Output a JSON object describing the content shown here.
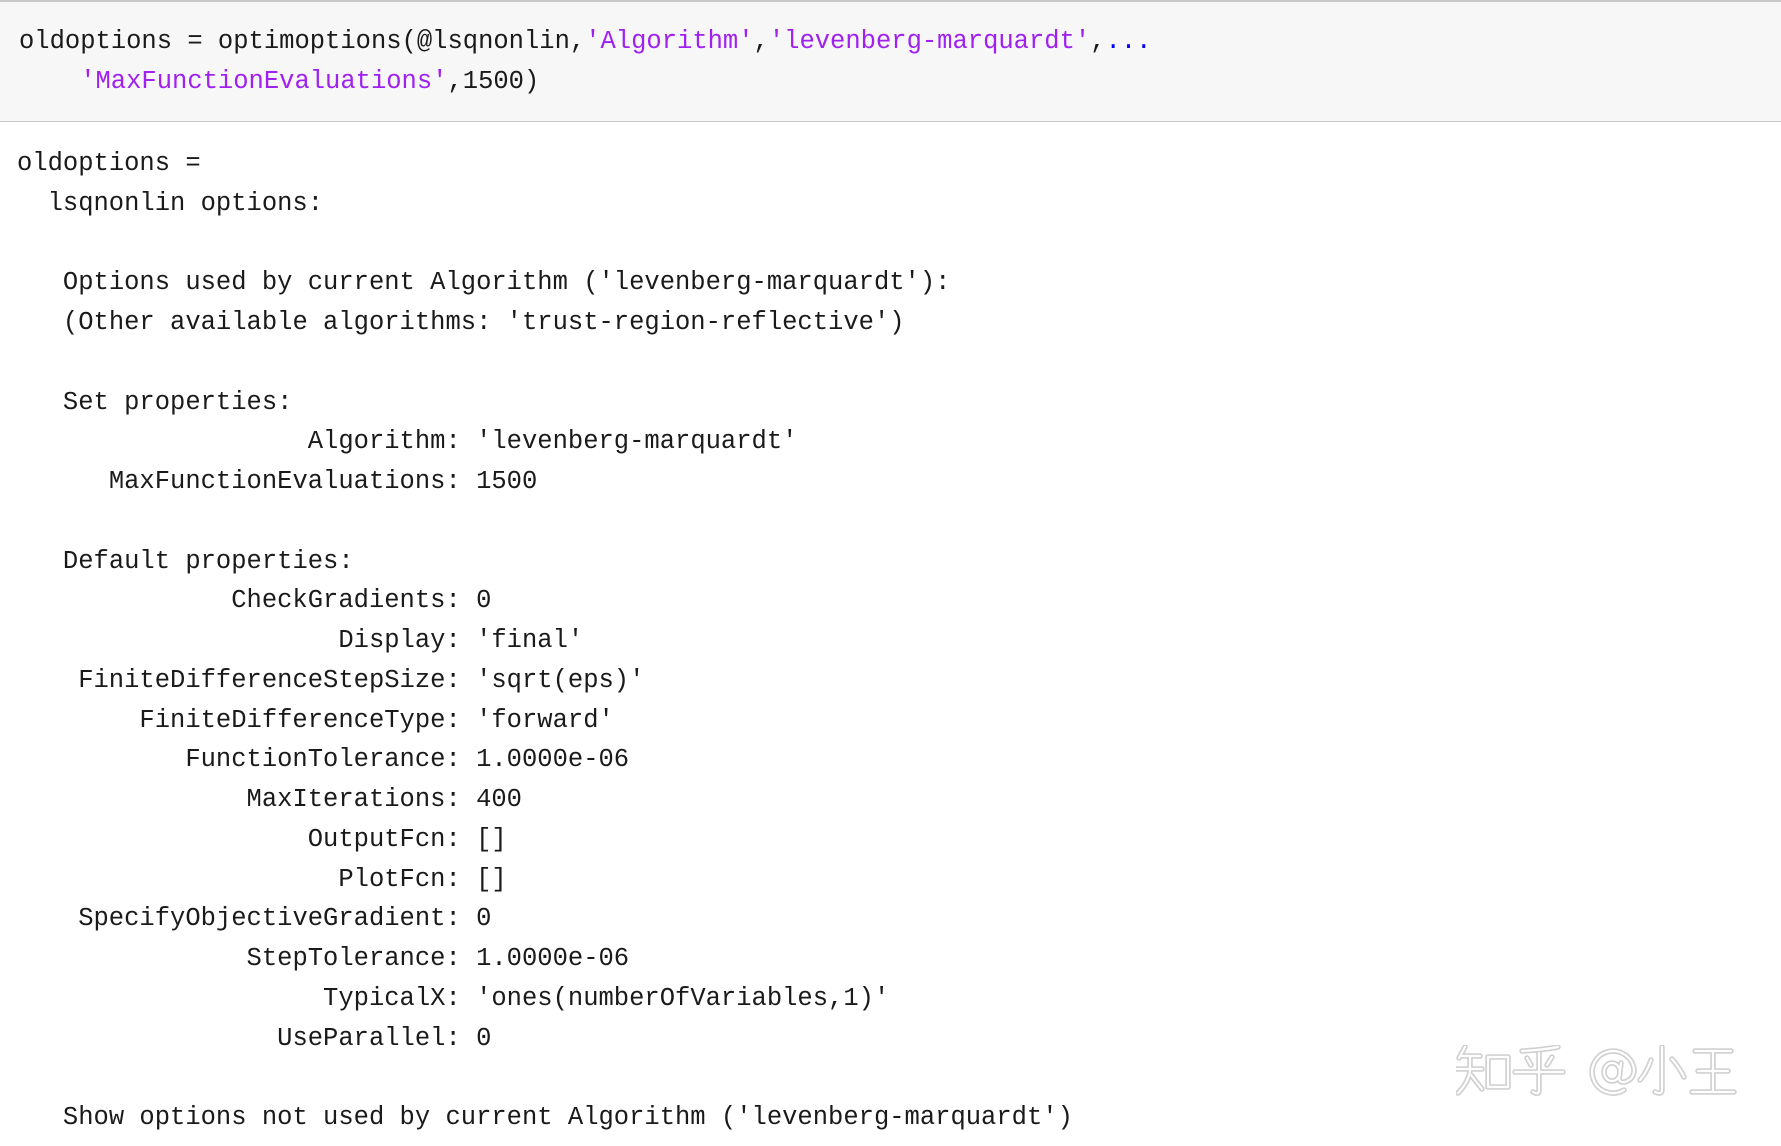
{
  "command": {
    "line1": {
      "prefix": "oldoptions = optimoptions(@lsqnonlin,",
      "str1": "'Algorithm'",
      "sep1": ",",
      "str2": "'levenberg-marquardt'",
      "sep2": ",",
      "continuation": "..."
    },
    "line2": {
      "str3": "'MaxFunctionEvaluations'",
      "suffix": ",1500)"
    }
  },
  "output": {
    "assignment": "oldoptions =",
    "object_header": "lsqnonlin options:",
    "algorithm_note": "Options used by current Algorithm ('levenberg-marquardt'):",
    "other_algorithms": "(Other available algorithms: 'trust-region-reflective')",
    "set_properties_heading": "Set properties:",
    "separator": ":",
    "set_properties": [
      {
        "name": "Algorithm",
        "value": "'levenberg-marquardt'"
      },
      {
        "name": "MaxFunctionEvaluations",
        "value": "1500"
      }
    ],
    "default_properties_heading": "Default properties:",
    "default_properties": [
      {
        "name": "CheckGradients",
        "value": "0"
      },
      {
        "name": "Display",
        "value": "'final'"
      },
      {
        "name": "FiniteDifferenceStepSize",
        "value": "'sqrt(eps)'"
      },
      {
        "name": "FiniteDifferenceType",
        "value": "'forward'"
      },
      {
        "name": "FunctionTolerance",
        "value": "1.0000e-06"
      },
      {
        "name": "MaxIterations",
        "value": "400"
      },
      {
        "name": "OutputFcn",
        "value": "[]"
      },
      {
        "name": "PlotFcn",
        "value": "[]"
      },
      {
        "name": "SpecifyObjectiveGradient",
        "value": "0"
      },
      {
        "name": "StepTolerance",
        "value": "1.0000e-06"
      },
      {
        "name": "TypicalX",
        "value": "'ones(numberOfVariables,1)'"
      },
      {
        "name": "UseParallel",
        "value": "0"
      }
    ],
    "show_unused_options": "Show options not used by current Algorithm ('levenberg-marquardt')"
  },
  "colors": {
    "code_background": "#f7f7f7",
    "string": "#a020f0",
    "continuation": "#0000ff",
    "text": "#1a1a1a",
    "rule": "#c9c9c9",
    "watermark": "#d0d0d0"
  },
  "watermark": "知乎 @小王"
}
